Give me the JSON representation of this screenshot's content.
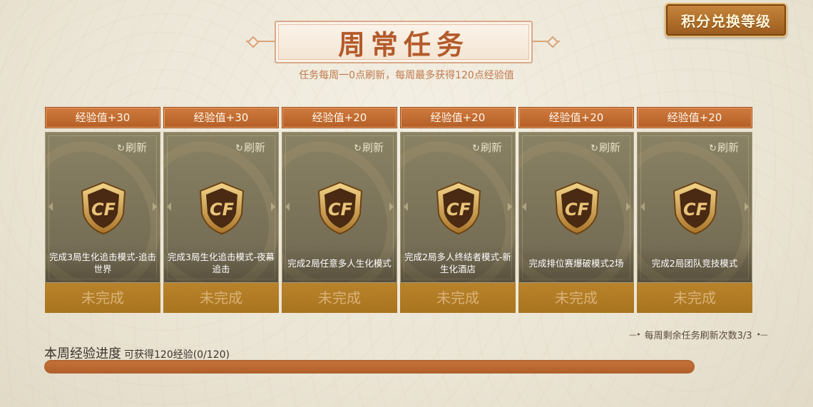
{
  "header": {
    "title": "周常任务",
    "subtitle": "任务每周一0点刷新，每周最多获得120点经验值",
    "exchange_button": "积分兑换等级"
  },
  "cards": [
    {
      "reward": "经验值+30",
      "refresh": "刷新",
      "desc": "完成3局生化追击模式-追击世界",
      "status": "未完成"
    },
    {
      "reward": "经验值+30",
      "refresh": "刷新",
      "desc": "完成3局生化追击模式-夜幕追击",
      "status": "未完成"
    },
    {
      "reward": "经验值+20",
      "refresh": "刷新",
      "desc": "完成2局任意多人生化模式",
      "status": "未完成"
    },
    {
      "reward": "经验值+20",
      "refresh": "刷新",
      "desc": "完成2局多人终结者模式-新生化酒店",
      "status": "未完成"
    },
    {
      "reward": "经验值+20",
      "refresh": "刷新",
      "desc": "完成排位赛爆破模式2场",
      "status": "未完成"
    },
    {
      "reward": "经验值+20",
      "refresh": "刷新",
      "desc": "完成2局团队竞技模式",
      "status": "未完成"
    }
  ],
  "refresh_count": "每周剩余任务刷新次数3/3",
  "progress": {
    "title": "本周经验进度",
    "detail": "可获得120经验(0/120)",
    "value": 0,
    "max": 120
  },
  "icons": {
    "refresh": "refresh-icon",
    "badge": "cf-shield-badge-icon"
  },
  "colors": {
    "accent": "#b45a2a",
    "header_orange": "#c56d32",
    "status_gold": "#b07a24"
  }
}
